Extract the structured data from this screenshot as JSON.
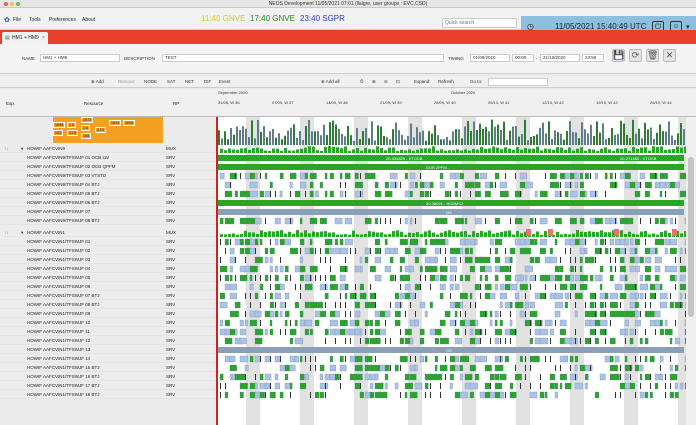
{
  "window": {
    "title": "NEOS Development 11/05/2021 07:01 (llaigre, user groups : EVC,CSD)"
  },
  "menu": {
    "file": "File",
    "tools": "Tools",
    "preferences": "Preferences",
    "about": "About"
  },
  "clocks": [
    {
      "label": "17:40 GNVE",
      "color": "#1f8a1f"
    },
    {
      "label": "23:40 SGPR",
      "color": "#2b3fd6"
    }
  ],
  "clock_hidden": "11:40 GNVE",
  "search": {
    "placeholder": "Quick search"
  },
  "utc": {
    "label": "11/05/2021 15:40:49 UTC"
  },
  "tab": {
    "label": "HM1 + HM9"
  },
  "form": {
    "name_label": "NAME",
    "name_value": "HM1 + HM9",
    "desc_label": "DESCRIPTION",
    "desc_value": "TEST",
    "timing_label": "TIMING",
    "start_date": "01/09/2020",
    "start_time": "00:00",
    "end_date": "31/10/2020",
    "end_time": "23:59"
  },
  "toolbar": {
    "add": "Add",
    "remove": "Remove",
    "node": "NODE",
    "sat": "SAT",
    "net": "NET",
    "dif": "DIF",
    "event": "Event",
    "add_all": "Add all",
    "expand": "Expand",
    "refresh": "Refresh",
    "goto": "Go to:"
  },
  "table": {
    "col_exp": "Exp.",
    "col_resource": "Resource",
    "col_rp": "RP"
  },
  "months": {
    "sep": "September 2020",
    "oct": "October 2020"
  },
  "weeks": [
    "31/08, W 36",
    "07/09, W 37",
    "14/09, W 38",
    "21/09, W 39",
    "28/09, W 40",
    "05/10, W 41",
    "12/10, W 42",
    "19/10, W 43",
    "26/10, W 44"
  ],
  "orange_chart": {
    "labels": [
      "1K72",
      "1K99",
      "1.6",
      "1.6",
      "3.15",
      "1K24",
      "1K3",
      "3.15",
      "1K8",
      "1K09"
    ]
  },
  "groups": [
    {
      "name": "HOWIF AAFCVIN9",
      "rp": "MUX"
    },
    {
      "name": "HOWIF AAFCVIN1",
      "rp": "MUX"
    }
  ],
  "rows_g1": [
    {
      "res": "HOWIF AAFCVIN9/TFSWJF 01 OCB LW",
      "rp": "SRV"
    },
    {
      "res": "HOWIF AAFCVIN9/TFSWJF 02 OCB QPFM",
      "rp": "SRV"
    },
    {
      "res": "HOWIF AAFCVIN9/TFSWJF 03 VTSTD",
      "rp": "SRV"
    },
    {
      "res": "HOWIF AAFCVIN9/TFSWJF 04 BTJ",
      "rp": "SRV"
    },
    {
      "res": "HOWIF AAFCVIN9/TFSWJF 05 BTJ",
      "rp": "SRV"
    },
    {
      "res": "HOWIF AAFCVIN9/TFSWJF 06 BTJ",
      "rp": "SRV"
    },
    {
      "res": "HOWIF AAFCVIN9/TFSWJF 07",
      "rp": "SRV"
    },
    {
      "res": "HOWIF AAFCVIN9/TFSWJF 08 BTJ",
      "rp": "SRV"
    }
  ],
  "rows_g2": [
    {
      "res": "HOWIF AAFCVIN1/TFSWJF 01",
      "rp": "SRV"
    },
    {
      "res": "HOWIF AAFCVIN1/TFSWJF 02",
      "rp": "SRV"
    },
    {
      "res": "HOWIF AAFCVIN1/TFSWJF 03",
      "rp": "SRV"
    },
    {
      "res": "HOWIF AAFCVIN1/TFSWJF 04",
      "rp": "SRV"
    },
    {
      "res": "HOWIF AAFCVIN1/TFSWJF 05",
      "rp": "SRV"
    },
    {
      "res": "HOWIF AAFCVIN1/TFSWJF 06",
      "rp": "SRV"
    },
    {
      "res": "HOWIF AAFCVIN1/TFSWJF 07 BTJ",
      "rp": "SRV"
    },
    {
      "res": "HOWIF AAFCVIN1/TFSWJF 08 BTJ",
      "rp": "SRV"
    },
    {
      "res": "HOWIF AAFCVIN1/TFSWJF 09",
      "rp": "SRV"
    },
    {
      "res": "HOWIF AAFCVIN1/TFSWJF 10",
      "rp": "SRV"
    },
    {
      "res": "HOWIF AAFCVIN1/TFSWJF 11",
      "rp": "SRV"
    },
    {
      "res": "HOWIF AAFCVIN1/TFSWJF 12",
      "rp": "SRV"
    },
    {
      "res": "HOWIF AAFCVIN1/TFSWJF 13",
      "rp": "SRV"
    },
    {
      "res": "HOWIF AAFCVIN1/TFSWJF 14",
      "rp": "SRV"
    },
    {
      "res": "HOWIF AAFCVIN1/TFSWJF 15 BTJ",
      "rp": "SRV"
    },
    {
      "res": "HOWIF AAFCVIN1/TFSWJF 16 BTJ",
      "rp": "SRV"
    },
    {
      "res": "HOWIF AAFCVIN1/TFSWJF 17 BTJ",
      "rp": "SRV"
    },
    {
      "res": "HOWIF AAFCVIN1/TFSWJF 18 BTJ",
      "rp": "SRV"
    }
  ],
  "bar_labels": {
    "g1_top_left": "20-334825 - VTOCB",
    "g1_top_right": "20-271485 - VTOCB",
    "g1_mid": "DOR.2PFM...",
    "g1_bottom": "20-38021 - HCBMC2",
    "os1": "OS",
    "os2": "OS"
  },
  "colors": {
    "accent": "#e8402a",
    "green": "#2aa52a",
    "blue": "#a9c2e6",
    "gray_band": "#cfcfcf",
    "orange": "#f5a020",
    "red_line": "#d8201a"
  }
}
